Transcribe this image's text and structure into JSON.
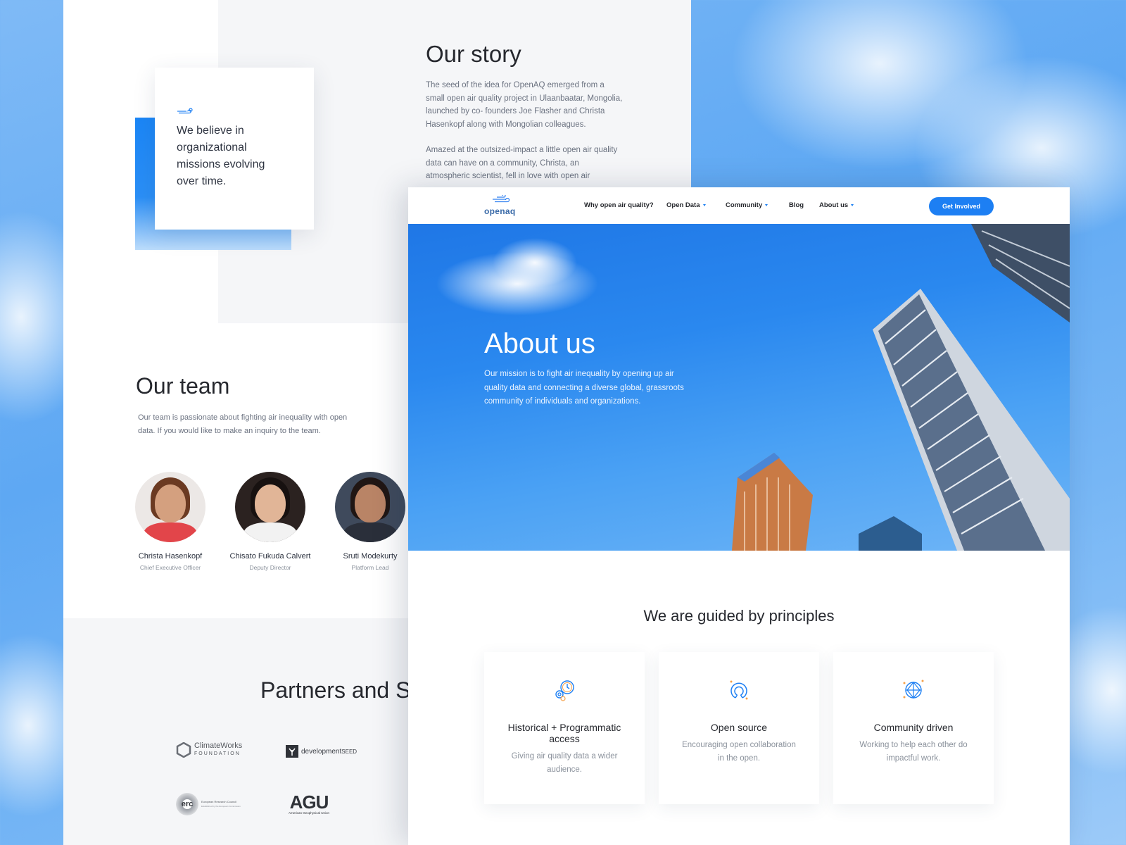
{
  "story": {
    "quote": "We believe in\norganizational\nmissions evolving\nover time.",
    "title": "Our story",
    "paragraph1": "The seed of the idea for OpenAQ emerged from a small open air quality project in Ulaanbaatar, Mongolia, launched by co- founders Joe Flasher and Christa Hasenkopf along with Mongolian colleagues.",
    "paragraph2": "Amazed at the outsized-impact a little open air quality data can have on a community, Christa, an atmospheric scientist, fell in love with open air"
  },
  "team": {
    "title": "Our team",
    "description": "Our team is passionate about fighting air inequality with open data. If you would like to make an inquiry to the team.",
    "members": [
      {
        "name": "Christa Hasenkopf",
        "role": "Chief Executive Officer"
      },
      {
        "name": "Chisato Fukuda Calvert",
        "role": "Deputy Director"
      },
      {
        "name": "Sruti Modekurty",
        "role": "Platform Lead"
      }
    ]
  },
  "partners": {
    "title": "Partners and S",
    "logos": [
      {
        "line1": "ClimateWorks",
        "line2": "FOUNDATION"
      },
      {
        "line1": "development",
        "line2": "SEED"
      },
      {
        "line1": "erc",
        "line2": "European Research Council",
        "line3": "Established by the European Commission"
      },
      {
        "line1": "AGU",
        "line2": "American Geophysical Union"
      }
    ]
  },
  "nav": {
    "brand": "openaq",
    "items": [
      {
        "label": "Why open air quality?"
      },
      {
        "label": "Open Data"
      },
      {
        "label": "Community"
      },
      {
        "label": "Blog"
      },
      {
        "label": "About us"
      }
    ],
    "cta": "Get Involved"
  },
  "hero": {
    "title": "About us",
    "text": "Our mission is to fight air inequality by opening up air quality data and connecting a diverse global, grassroots community of individuals and organizations."
  },
  "principles": {
    "title": "We are guided by principles",
    "cards": [
      {
        "title": "Historical + Programmatic access",
        "desc": "Giving air quality data a wider audience.",
        "icon": "gears-clock-icon"
      },
      {
        "title": "Open source",
        "desc": "Encouraging open collaboration in the open.",
        "icon": "open-source-icon"
      },
      {
        "title": "Community driven",
        "desc": "Working to help each other do impactful work.",
        "icon": "network-globe-icon"
      }
    ]
  },
  "colors": {
    "accent": "#1d7ff3",
    "sky": "#2a88ef",
    "heading": "#26282e",
    "muted": "#8b929c"
  }
}
